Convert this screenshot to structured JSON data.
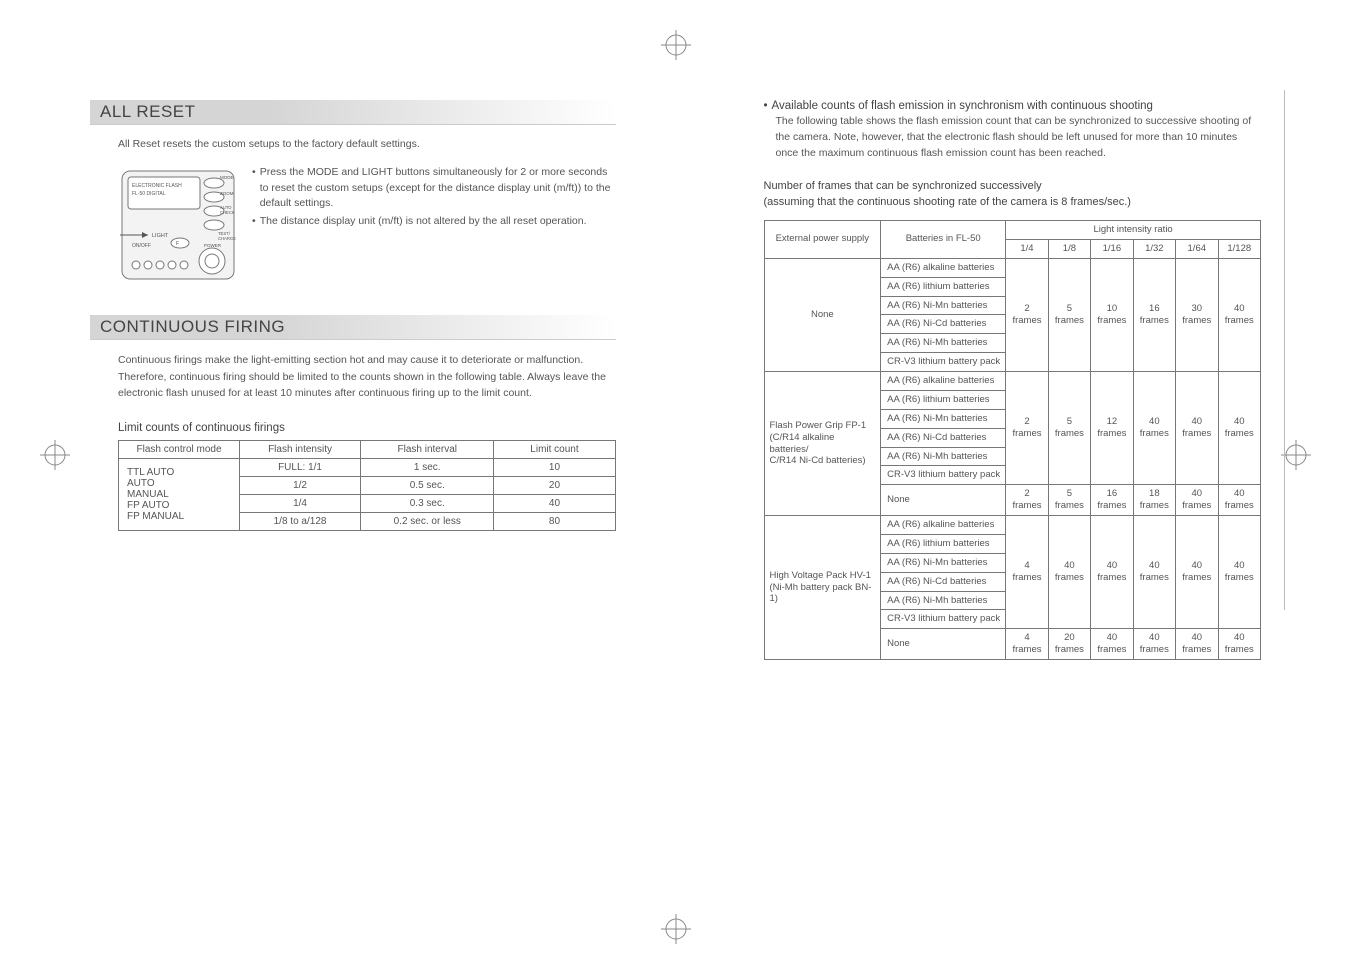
{
  "left": {
    "all_reset": {
      "heading": "ALL RESET",
      "intro": "All Reset resets the custom setups to the factory default settings.",
      "bullets": [
        "Press the MODE and LIGHT buttons simultaneously for 2 or more seconds to reset the custom setups (except for the distance display unit (m/ft)) to the default settings.",
        "The distance display unit (m/ft) is not altered by the all reset operation."
      ],
      "device_labels": {
        "title1": "ELECTRONIC FLASH",
        "title2": "FL-50 DIGITAL",
        "mode": "MODE",
        "zoom": "ZOOM",
        "auto": "AUTO\nCHECK",
        "test": "TEST/\nCHARGE",
        "light": "LIGHT",
        "onoff": "ON/OFF",
        "f": "F",
        "power": "POWER"
      }
    },
    "continuous": {
      "heading": "CONTINUOUS FIRING",
      "para": "Continuous firings make the light-emitting section hot and may cause it to deteriorate or malfunction. Therefore, continuous firing should be limited to the counts shown in the following table. Always leave the electronic flash unused for at least 10 minutes after continuous firing up to the limit count.",
      "sub_heading": "Limit counts of continuous firings",
      "table": {
        "headers": [
          "Flash control mode",
          "Flash intensity",
          "Flash interval",
          "Limit count"
        ],
        "modes_cell": "TTL AUTO\nAUTO\nMANUAL\nFP AUTO\nFP MANUAL",
        "rows": [
          {
            "intensity": "FULL: 1/1",
            "interval": "1 sec.",
            "count": "10"
          },
          {
            "intensity": "1/2",
            "interval": "0.5 sec.",
            "count": "20"
          },
          {
            "intensity": "1/4",
            "interval": "0.3 sec.",
            "count": "40"
          },
          {
            "intensity": "1/8 to a/128",
            "interval": "0.2 sec. or less",
            "count": "80"
          }
        ]
      }
    }
  },
  "right": {
    "bullet_title": "Available counts of flash emission in synchronism with continuous shooting",
    "bullet_desc": "The following table shows the flash emission count that can be synchronized to successive shooting of the camera. Note, however, that the electronic flash should be left unused for more than 10 minutes once the maximum continuous flash emission count has been reached.",
    "sub_heading": "Number of frames that can be synchronized successively\n(assuming that the continuous shooting rate of the camera is 8 frames/sec.)",
    "table": {
      "top_header": "Light intensity ratio",
      "col_headers": [
        "External power supply",
        "Batteries in FL-50",
        "1/4",
        "1/8",
        "1/16",
        "1/32",
        "1/64",
        "1/128"
      ],
      "battery_types": [
        "AA (R6) alkaline batteries",
        "AA (R6) lithium batteries",
        "AA (R6) Ni-Mn batteries",
        "AA (R6) Ni-Cd batteries",
        "AA (R6) Ni-Mh batteries",
        "CR-V3 lithium battery pack"
      ],
      "groups": [
        {
          "ext": "None",
          "values": [
            "2\nframes",
            "5\nframes",
            "10\nframes",
            "16\nframes",
            "30\nframes",
            "40\nframes"
          ]
        },
        {
          "ext": "Flash Power Grip FP-1\n(C/R14 alkaline batteries/\nC/R14 Ni-Cd batteries)",
          "values": [
            "2\nframes",
            "5\nframes",
            "12\nframes",
            "40\nframes",
            "40\nframes",
            "40\nframes"
          ],
          "none_row": [
            "None",
            "2\nframes",
            "5\nframes",
            "16\nframes",
            "18\nframes",
            "40\nframes",
            "40\nframes"
          ]
        },
        {
          "ext": "High Voltage Pack HV-1\n(Ni-Mh battery pack BN-1)",
          "values": [
            "4\nframes",
            "40\nframes",
            "40\nframes",
            "40\nframes",
            "40\nframes",
            "40\nframes"
          ],
          "none_row": [
            "None",
            "4\nframes",
            "20\nframes",
            "40\nframes",
            "40\nframes",
            "40\nframes",
            "40\nframes"
          ]
        }
      ]
    }
  }
}
